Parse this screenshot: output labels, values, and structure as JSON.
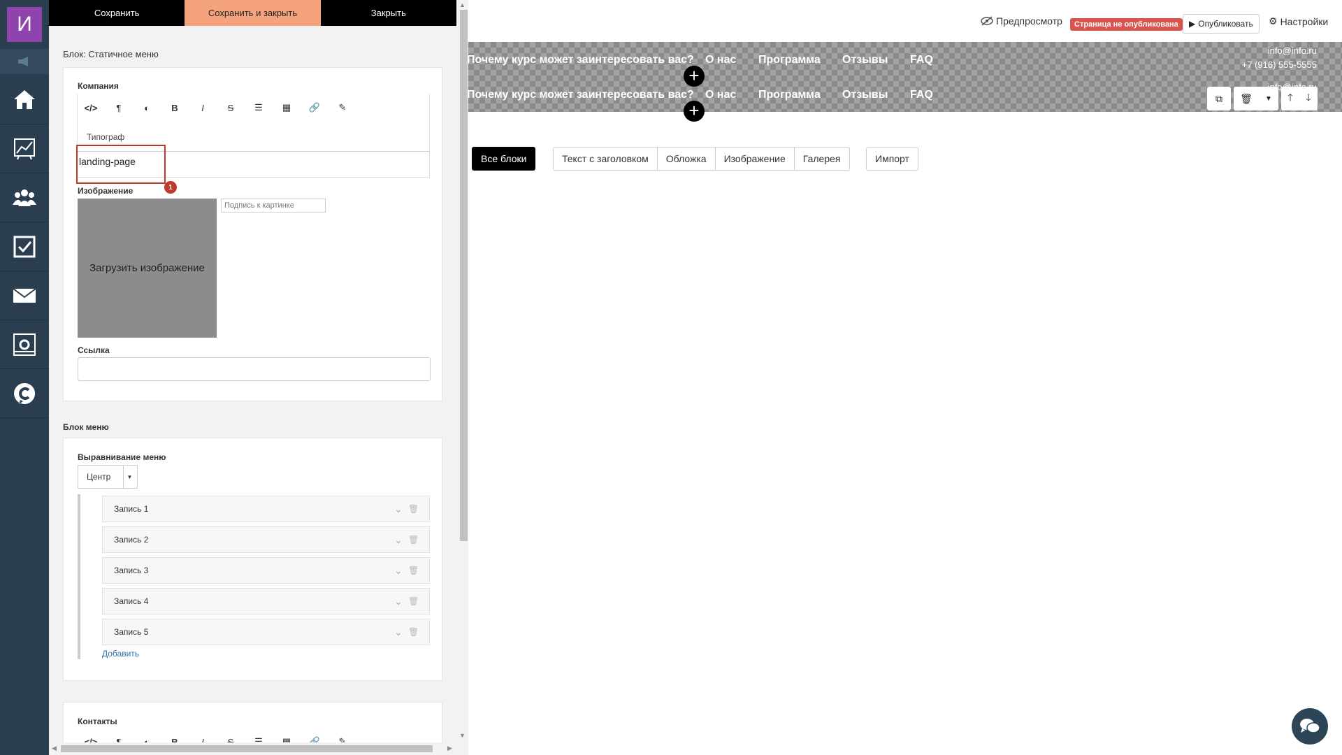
{
  "sidebar": {
    "logo_letter": "И",
    "items": [
      {
        "icon": "home-icon"
      },
      {
        "icon": "chart-icon"
      },
      {
        "icon": "users-icon"
      },
      {
        "icon": "tasks-icon"
      },
      {
        "icon": "mail-icon"
      },
      {
        "icon": "settings-panel-icon"
      },
      {
        "icon": "chat-c-icon"
      }
    ]
  },
  "editor": {
    "toolbar": {
      "save": "Сохранить",
      "save_close": "Сохранить и закрыть",
      "close": "Закрыть"
    },
    "block_title": "Блок: Статичное меню",
    "company": {
      "label": "Компания",
      "typograph_tab": "Типограф",
      "text_value": "landing-page",
      "callout_number": "1"
    },
    "image": {
      "label": "Изображение",
      "upload_label": "Загрузить изображение",
      "caption_placeholder": "Подпись к картинке"
    },
    "link": {
      "label": "Ссылка",
      "value": ""
    },
    "menu_block": {
      "title": "Блок меню",
      "align_label": "Выравнивание меню",
      "align_value": "Центр",
      "entries": [
        "Запись 1",
        "Запись 2",
        "Запись 3",
        "Запись 4",
        "Запись 5"
      ],
      "add_label": "Добавить"
    },
    "contacts": {
      "label": "Контакты"
    }
  },
  "preview": {
    "topbar": {
      "preview_label": "Предпросмотр",
      "not_published": "Страница не опубликована",
      "publish_label": "Опубликовать",
      "settings_label": "Настройки"
    },
    "menu": {
      "items": [
        "Почему курс может заинтересовать вас?",
        "О нас",
        "Программа",
        "Отзывы",
        "FAQ"
      ],
      "email": "info@info.ru",
      "phone": "+7 (916) 555-5555",
      "email_partial": "info@info.ru",
      "phone_partial": "55"
    },
    "filters": {
      "all_blocks": "Все блоки",
      "tabs": [
        "Текст с заголовком",
        "Обложка",
        "Изображение",
        "Галерея"
      ],
      "import": "Импорт"
    }
  },
  "colors": {
    "sidebar_bg": "#2b3e50",
    "logo_bg": "#8e44ad",
    "save_close_bg": "#f4a37d",
    "not_published_bg": "#d9534f",
    "highlight": "#c0392b"
  }
}
